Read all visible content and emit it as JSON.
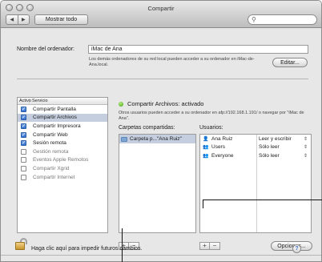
{
  "window": {
    "title": "Compartir",
    "nav_back": "◀",
    "nav_forward": "▶",
    "show_all": "Mostrar todo",
    "search_placeholder": ""
  },
  "computer_name": {
    "label": "Nombre del ordenador:",
    "value": "iMac de Ana",
    "help": "Los demás ordenadores de su red local pueden acceder a su ordenador en iMac-de-Ana.local.",
    "edit_button": "Editar..."
  },
  "services": {
    "col_active": "Activo",
    "col_service": "Servicio",
    "items": [
      {
        "label": "Compartir Pantalla",
        "checked": true,
        "selected": false
      },
      {
        "label": "Compartir Archivos",
        "checked": true,
        "selected": true
      },
      {
        "label": "Compartir Impresora",
        "checked": true,
        "selected": false
      },
      {
        "label": "Compartir Web",
        "checked": true,
        "selected": false
      },
      {
        "label": "Sesión remota",
        "checked": true,
        "selected": false
      },
      {
        "label": "Gestión remota",
        "checked": false,
        "selected": false
      },
      {
        "label": "Eventos Apple Remotos",
        "checked": false,
        "selected": false
      },
      {
        "label": "Compartir Xgrid",
        "checked": false,
        "selected": false
      },
      {
        "label": "Compartir Internet",
        "checked": false,
        "selected": false
      }
    ]
  },
  "status": {
    "text": "Compartir Archivos: activado",
    "description": "Otros usuarios pueden acceder a su ordenador en afp://192.168.1.191/ o navegar por \"iMac de Ana\"."
  },
  "shared_folders": {
    "label": "Carpetas compartidas:",
    "items": [
      "Carpeta p...\"Ana Ruiz\""
    ]
  },
  "users": {
    "label": "Usuarios:",
    "items": [
      {
        "name": "Ana Ruiz",
        "permission": "Leer y escribir",
        "icon": "single-user-icon"
      },
      {
        "name": "Users",
        "permission": "Sólo leer",
        "icon": "group-icon"
      },
      {
        "name": "Everyone",
        "permission": "Sólo leer",
        "icon": "group-icon"
      }
    ]
  },
  "buttons": {
    "add": "+",
    "remove": "−",
    "options": "Opciones..."
  },
  "lock": {
    "text": "Haga clic aquí para impedir futuros cambios."
  },
  "help": "?"
}
